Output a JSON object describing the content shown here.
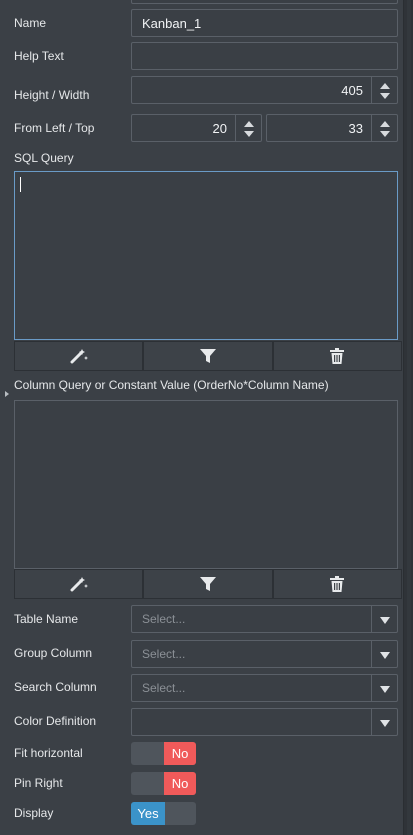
{
  "fields": {
    "name": {
      "label": "Name",
      "value": "Kanban_1"
    },
    "help_text": {
      "label": "Help Text",
      "value": ""
    },
    "height_width": {
      "label": "Height / Width",
      "value": "405"
    },
    "from_left_top": {
      "label": "From Left / Top",
      "left": "20",
      "top": "33"
    }
  },
  "sql_query": {
    "label": "SQL Query",
    "value": ""
  },
  "column_query": {
    "label": "Column Query or Constant Value (OrderNo*Column Name)",
    "value": ""
  },
  "toolbar": {
    "icons": [
      "magic-wand-icon",
      "filter-icon",
      "trash-icon"
    ]
  },
  "selects": {
    "table_name": {
      "label": "Table Name",
      "placeholder": "Select..."
    },
    "group_column": {
      "label": "Group Column",
      "placeholder": "Select..."
    },
    "search_column": {
      "label": "Search Column",
      "placeholder": "Select..."
    },
    "color_definition": {
      "label": "Color Definition",
      "placeholder": ""
    }
  },
  "toggles": {
    "fit_horizontal": {
      "label": "Fit horizontal",
      "state": "No"
    },
    "pin_right": {
      "label": "Pin Right",
      "state": "No"
    },
    "display": {
      "label": "Display",
      "state": "Yes"
    }
  },
  "colors": {
    "toggle_off": "#f05a5a",
    "toggle_on": "#3b93c9",
    "focus_border": "#6a9bc7"
  }
}
